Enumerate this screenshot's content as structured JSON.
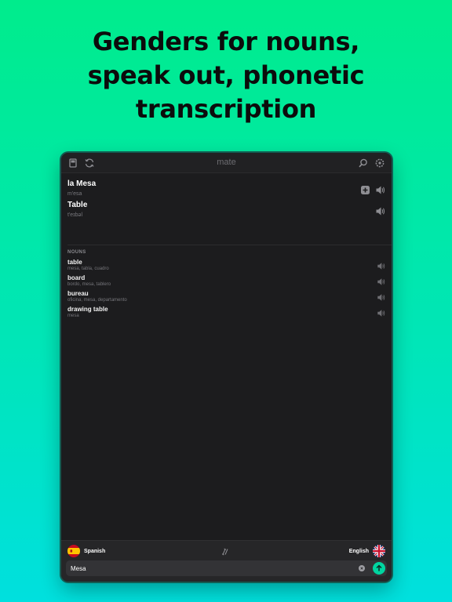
{
  "promo": {
    "headline_lines": [
      "Genders for nouns,",
      "speak out, phonetic",
      "transcription"
    ]
  },
  "app": {
    "title": "mate",
    "toolbar_icons": [
      "phrasebook-icon",
      "history-icon",
      "search-icon",
      "settings-icon"
    ]
  },
  "translation": {
    "source": {
      "word": "la Mesa",
      "phonetic": "m'esa"
    },
    "target": {
      "word": "Table",
      "phonetic": "t'eɪbəl"
    }
  },
  "nouns": {
    "section_label": "NOUNS",
    "items": [
      {
        "word": "table",
        "synonyms": "mesa, tabla, cuadro"
      },
      {
        "word": "board",
        "synonyms": "bordo, mesa, tablero"
      },
      {
        "word": "bureau",
        "synonyms": "oficina, mesa, departamento"
      },
      {
        "word": "drawing table",
        "synonyms": "mesa"
      }
    ]
  },
  "bottom_bar": {
    "source_lang": "Spanish",
    "target_lang": "English",
    "input_value": "Mesa",
    "input_placeholder": ""
  },
  "colors": {
    "background_top": "#00ec8c",
    "background_bottom": "#00e0de",
    "device_bg": "#1c1c1e",
    "send_button": "#00d4a0"
  }
}
